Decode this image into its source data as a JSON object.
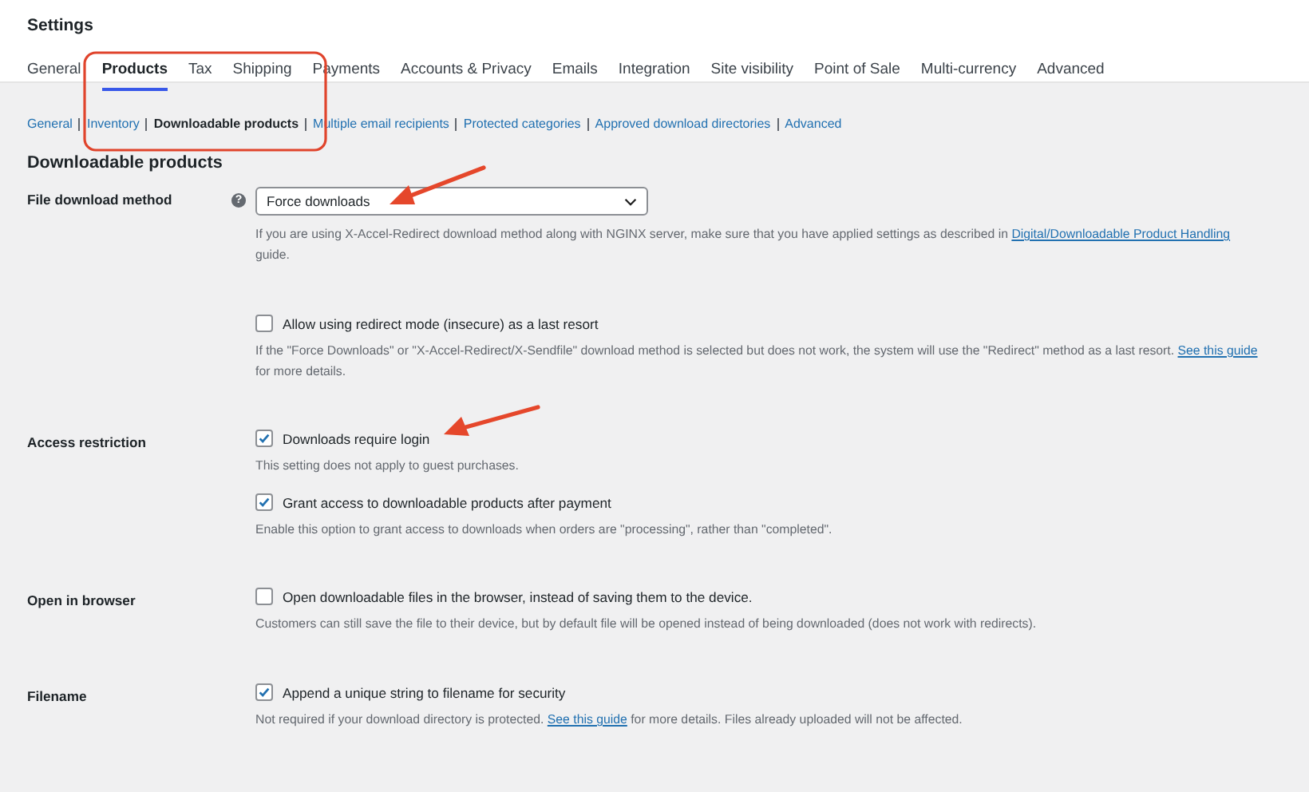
{
  "page_title": "Settings",
  "tabs": [
    {
      "label": "General",
      "selected": false
    },
    {
      "label": "Products",
      "selected": true
    },
    {
      "label": "Tax",
      "selected": false
    },
    {
      "label": "Shipping",
      "selected": false
    },
    {
      "label": "Payments",
      "selected": false
    },
    {
      "label": "Accounts & Privacy",
      "selected": false
    },
    {
      "label": "Emails",
      "selected": false
    },
    {
      "label": "Integration",
      "selected": false
    },
    {
      "label": "Site visibility",
      "selected": false
    },
    {
      "label": "Point of Sale",
      "selected": false
    },
    {
      "label": "Multi-currency",
      "selected": false
    },
    {
      "label": "Advanced",
      "selected": false
    }
  ],
  "subnav": [
    {
      "label": "General",
      "selected": false
    },
    {
      "label": "Inventory",
      "selected": false
    },
    {
      "label": "Downloadable products",
      "selected": true
    },
    {
      "label": "Multiple email recipients",
      "selected": false
    },
    {
      "label": "Protected categories",
      "selected": false
    },
    {
      "label": "Approved download directories",
      "selected": false
    },
    {
      "label": "Advanced",
      "selected": false
    }
  ],
  "section_title": "Downloadable products",
  "settings": [
    {
      "label": "File download method",
      "help": "?",
      "items": [
        {
          "kind": "select",
          "value": "Force downloads"
        },
        {
          "kind": "note",
          "segments": [
            {
              "text": "If you are using X-Accel-Redirect download method along with NGINX server, make sure that you have applied settings as described in ",
              "link": false
            },
            {
              "text": "Digital/Downloadable Product Handling",
              "link": true
            },
            {
              "text": " guide.",
              "link": false
            }
          ]
        },
        {
          "kind": "checkbox",
          "label": "Allow using redirect mode (insecure) as a last resort",
          "checked": false
        },
        {
          "kind": "note",
          "segments": [
            {
              "text": "If the \"Force Downloads\" or \"X-Accel-Redirect/X-Sendfile\" download method is selected but does not work, the system will use the \"Redirect\" method as a last resort. ",
              "link": false
            },
            {
              "text": "See this guide",
              "link": true
            },
            {
              "text": " for more details.",
              "link": false
            }
          ]
        }
      ]
    },
    {
      "label": "Access restriction",
      "items": [
        {
          "kind": "checkbox",
          "label": "Downloads require login",
          "checked": true
        },
        {
          "kind": "note",
          "segments": [
            {
              "text": "This setting does not apply to guest purchases.",
              "link": false
            }
          ]
        },
        {
          "kind": "checkbox",
          "label": "Grant access to downloadable products after payment",
          "checked": true
        },
        {
          "kind": "note",
          "segments": [
            {
              "text": "Enable this option to grant access to downloads when orders are \"processing\", rather than \"completed\".",
              "link": false
            }
          ]
        }
      ]
    },
    {
      "label": "Open in browser",
      "items": [
        {
          "kind": "checkbox",
          "label": "Open downloadable files in the browser, instead of saving them to the device.",
          "checked": false
        },
        {
          "kind": "note",
          "segments": [
            {
              "text": "Customers can still save the file to their device, but by default file will be opened instead of being downloaded (does not work with redirects).",
              "link": false
            }
          ]
        }
      ]
    },
    {
      "label": "Filename",
      "items": [
        {
          "kind": "checkbox",
          "label": "Append a unique string to filename for security",
          "checked": true
        },
        {
          "kind": "note",
          "segments": [
            {
              "text": "Not required if your download directory is protected. ",
              "link": false
            },
            {
              "text": "See this guide",
              "link": true
            },
            {
              "text": " for more details. Files already uploaded will not be affected.",
              "link": false
            }
          ]
        }
      ]
    }
  ]
}
